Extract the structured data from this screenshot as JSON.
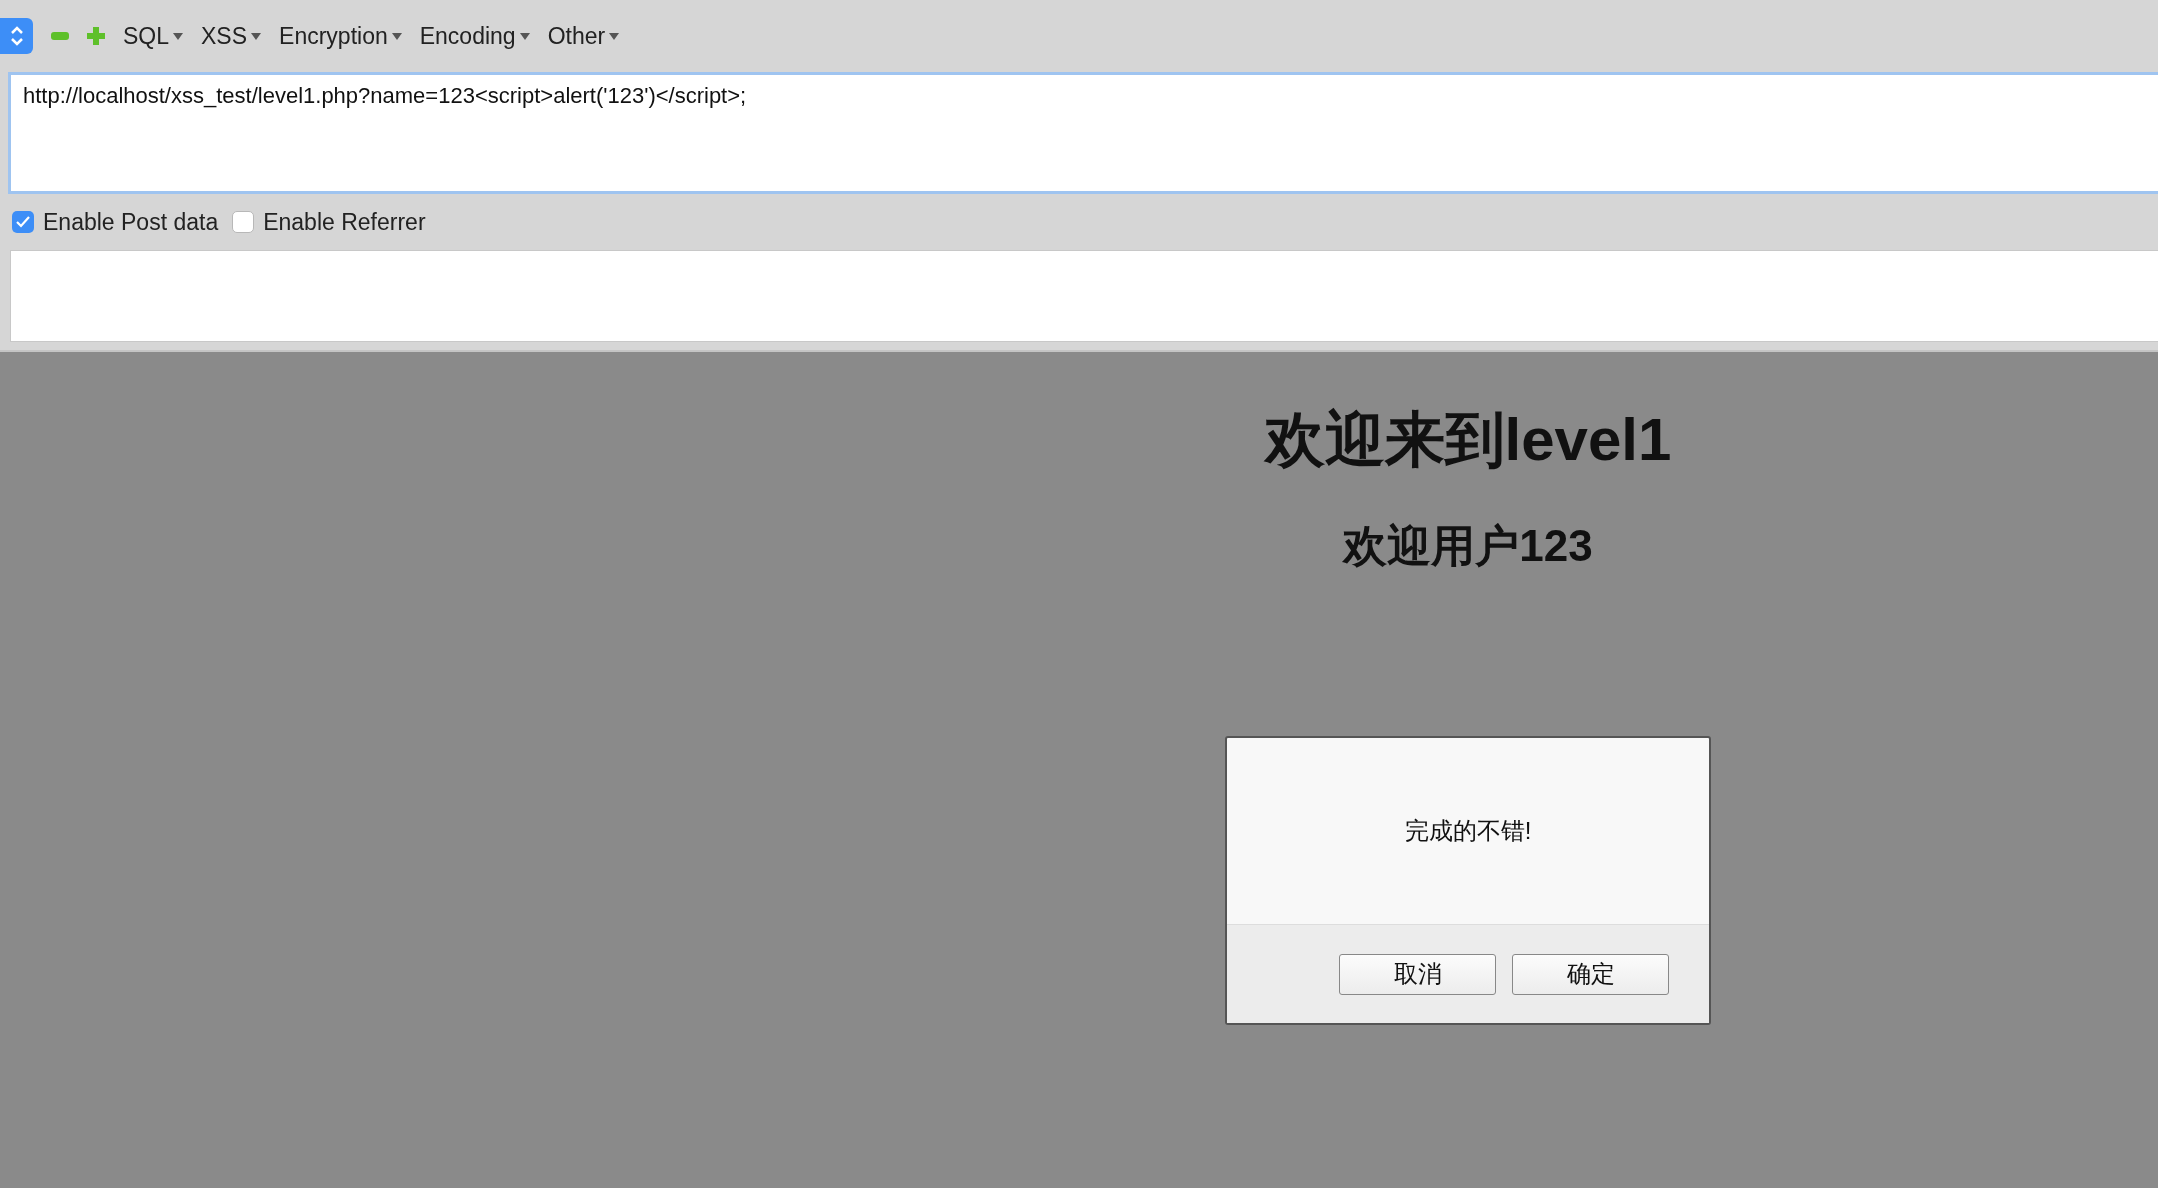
{
  "toolbar": {
    "menus": [
      {
        "label": "SQL"
      },
      {
        "label": "XSS"
      },
      {
        "label": "Encryption"
      },
      {
        "label": "Encoding"
      },
      {
        "label": "Other"
      }
    ]
  },
  "url_field": {
    "value": "http://localhost/xss_test/level1.php?name=123<script>alert('123')</script>;"
  },
  "options": [
    {
      "label": "Enable Post data",
      "checked": true
    },
    {
      "label": "Enable Referrer",
      "checked": false
    }
  ],
  "page": {
    "heading": "欢迎来到level1",
    "subheading": "欢迎用户123"
  },
  "dialog": {
    "message": "完成的不错!",
    "buttons": [
      {
        "label": "取消"
      },
      {
        "label": "确定"
      }
    ]
  }
}
